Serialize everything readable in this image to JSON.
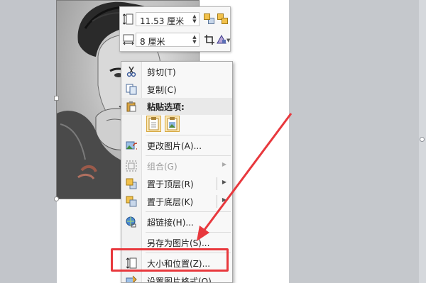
{
  "mini_toolbar": {
    "height_value": "11.53 厘米",
    "width_value": "8 厘米",
    "icons": [
      "shape-height-icon",
      "shape-width-icon",
      "bring-forward-icon",
      "send-backward-icon",
      "crop-icon",
      "shape-fill-icon"
    ]
  },
  "context_menu": {
    "items": [
      {
        "label": "剪切(T)",
        "icon": "scissors-icon"
      },
      {
        "label": "复制(C)",
        "icon": "copy-icon"
      },
      {
        "label": "粘贴选项:",
        "icon": "paste-icon"
      },
      {
        "label": "更改图片(A)...",
        "icon": "change-picture-icon"
      },
      {
        "label": "组合(G)",
        "icon": "group-icon",
        "disabled": true
      },
      {
        "label": "置于顶层(R)",
        "icon": "bring-to-front-icon"
      },
      {
        "label": "置于底层(K)",
        "icon": "send-to-back-icon"
      },
      {
        "label": "超链接(H)...",
        "icon": "hyperlink-icon"
      },
      {
        "label": "另存为图片(S)...",
        "icon": "save-as-picture-icon"
      },
      {
        "label": "大小和位置(Z)...",
        "icon": "size-position-icon"
      },
      {
        "label": "设置图片格式(O)...",
        "icon": "format-picture-icon"
      }
    ]
  },
  "highlight_color": "#e8383d"
}
